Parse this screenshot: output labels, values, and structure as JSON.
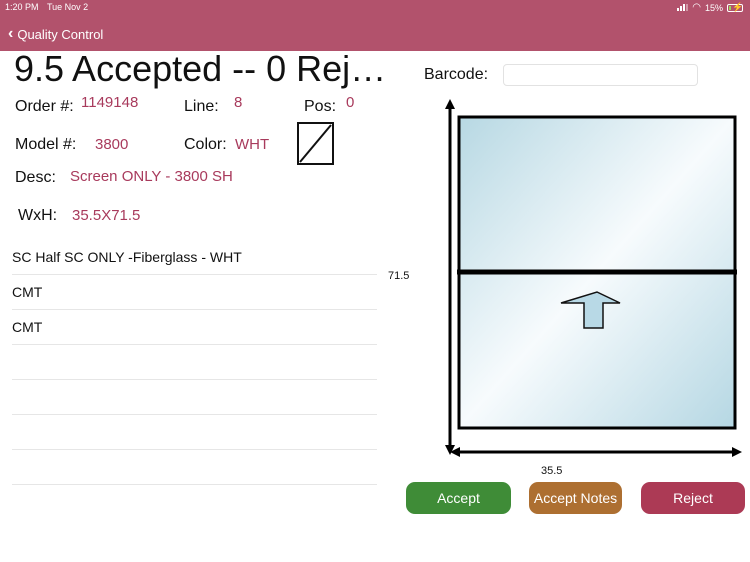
{
  "status_bar": {
    "time": "1:20 PM",
    "date": "Tue Nov 2",
    "battery": "15%",
    "battery_level": 0.15
  },
  "nav": {
    "back_label": "Quality Control"
  },
  "header": {
    "title": "9.5 Accepted -- 0 Rej…"
  },
  "order": {
    "order_label": "Order #:",
    "order_value": "1149148",
    "line_label": "Line:",
    "line_value": "8",
    "pos_label": "Pos:",
    "pos_value": "0",
    "model_label": "Model #:",
    "model_value": "3800",
    "color_label": "Color:",
    "color_value": "WHT",
    "desc_label": "Desc:",
    "desc_value": "Screen ONLY - 3800 SH",
    "wxh_label": "WxH:",
    "wxh_value": "35.5X71.5"
  },
  "barcode": {
    "label": "Barcode:",
    "value": "",
    "placeholder": ""
  },
  "components": [
    "SC Half SC ONLY -Fiberglass - WHT",
    "CMT",
    "CMT",
    "",
    "",
    "",
    ""
  ],
  "diagram": {
    "height_label": "71.5",
    "width_label": "35.5",
    "direction": "up"
  },
  "actions": {
    "accept": "Accept",
    "accept_notes": "Accept Notes",
    "reject": "Reject"
  },
  "colors": {
    "brand": "#b2526c",
    "value_text": "#a83a5c",
    "accept": "#3f8c37",
    "accept_notes": "#ad6f31",
    "reject": "#ac3a55"
  }
}
